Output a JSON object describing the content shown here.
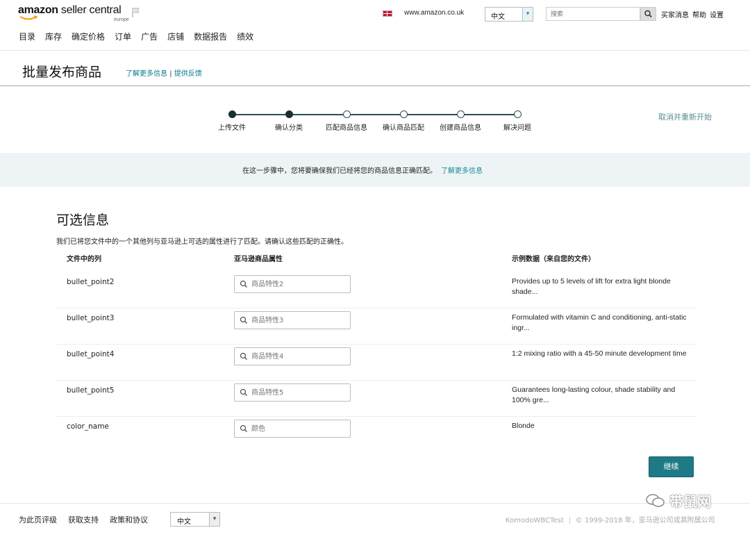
{
  "header": {
    "logo_bold": "amazon",
    "logo_light": " seller central",
    "logo_region": "europe",
    "domain": "www.amazon.co.uk",
    "language": "中文",
    "search_placeholder": "搜索",
    "links": [
      "买家消息",
      "帮助",
      "设置"
    ]
  },
  "nav": [
    "目录",
    "库存",
    "确定价格",
    "订单",
    "广告",
    "店铺",
    "数据报告",
    "绩效"
  ],
  "page": {
    "title": "批量发布商品",
    "learn_more": "了解更多信息",
    "feedback": "提供反馈",
    "separator": "|"
  },
  "stepper": {
    "steps": [
      {
        "label": "上传文件",
        "done": true
      },
      {
        "label": "确认分类",
        "done": true
      },
      {
        "label": "匹配商品信息",
        "done": false
      },
      {
        "label": "确认商品匹配",
        "done": false
      },
      {
        "label": "创建商品信息",
        "done": false
      },
      {
        "label": "解决问题",
        "done": false
      }
    ],
    "restart": "取消并重新开始"
  },
  "banner": {
    "text": "在这一步骤中，您将要确保我们已经将您的商品信息正确匹配。",
    "link": "了解更多信息"
  },
  "section": {
    "title": "可选信息",
    "description": "我们已将您文件中的一个其他列与亚马逊上可选的属性进行了匹配。请确认这些匹配的正确性。",
    "columns": [
      "文件中的列",
      "亚马逊商品属性",
      "示例数据（来自您的文件）"
    ],
    "rows": [
      {
        "column": "bullet_point2",
        "attribute_placeholder": "商品特性2",
        "sample": "Provides up to 5 levels of lift for extra light blonde shade..."
      },
      {
        "column": "bullet_point3",
        "attribute_placeholder": "商品特性3",
        "sample": "Formulated with vitamin C and conditioning, anti-static ingr..."
      },
      {
        "column": "bullet_point4",
        "attribute_placeholder": "商品特性4",
        "sample": "1:2 mixing ratio with a 45-50 minute development time"
      },
      {
        "column": "bullet_point5",
        "attribute_placeholder": "商品特性5",
        "sample": "Guarantees long-lasting colour, shade stability and 100% gre..."
      },
      {
        "column": "color_name",
        "attribute_placeholder": "颜色",
        "sample": "Blonde"
      }
    ],
    "continue": "继续"
  },
  "footer": {
    "links": [
      "为此页评级",
      "获取支持",
      "政策和协议"
    ],
    "language": "中文",
    "account": "KomodoWBCTest",
    "copyright": "© 1999-2018 年，亚马逊公司或其附属公司"
  },
  "watermark": "带鼠网",
  "colors": {
    "accent": "#1e7a86",
    "link": "#0a7b8a",
    "banner_bg": "#eef4f6"
  }
}
